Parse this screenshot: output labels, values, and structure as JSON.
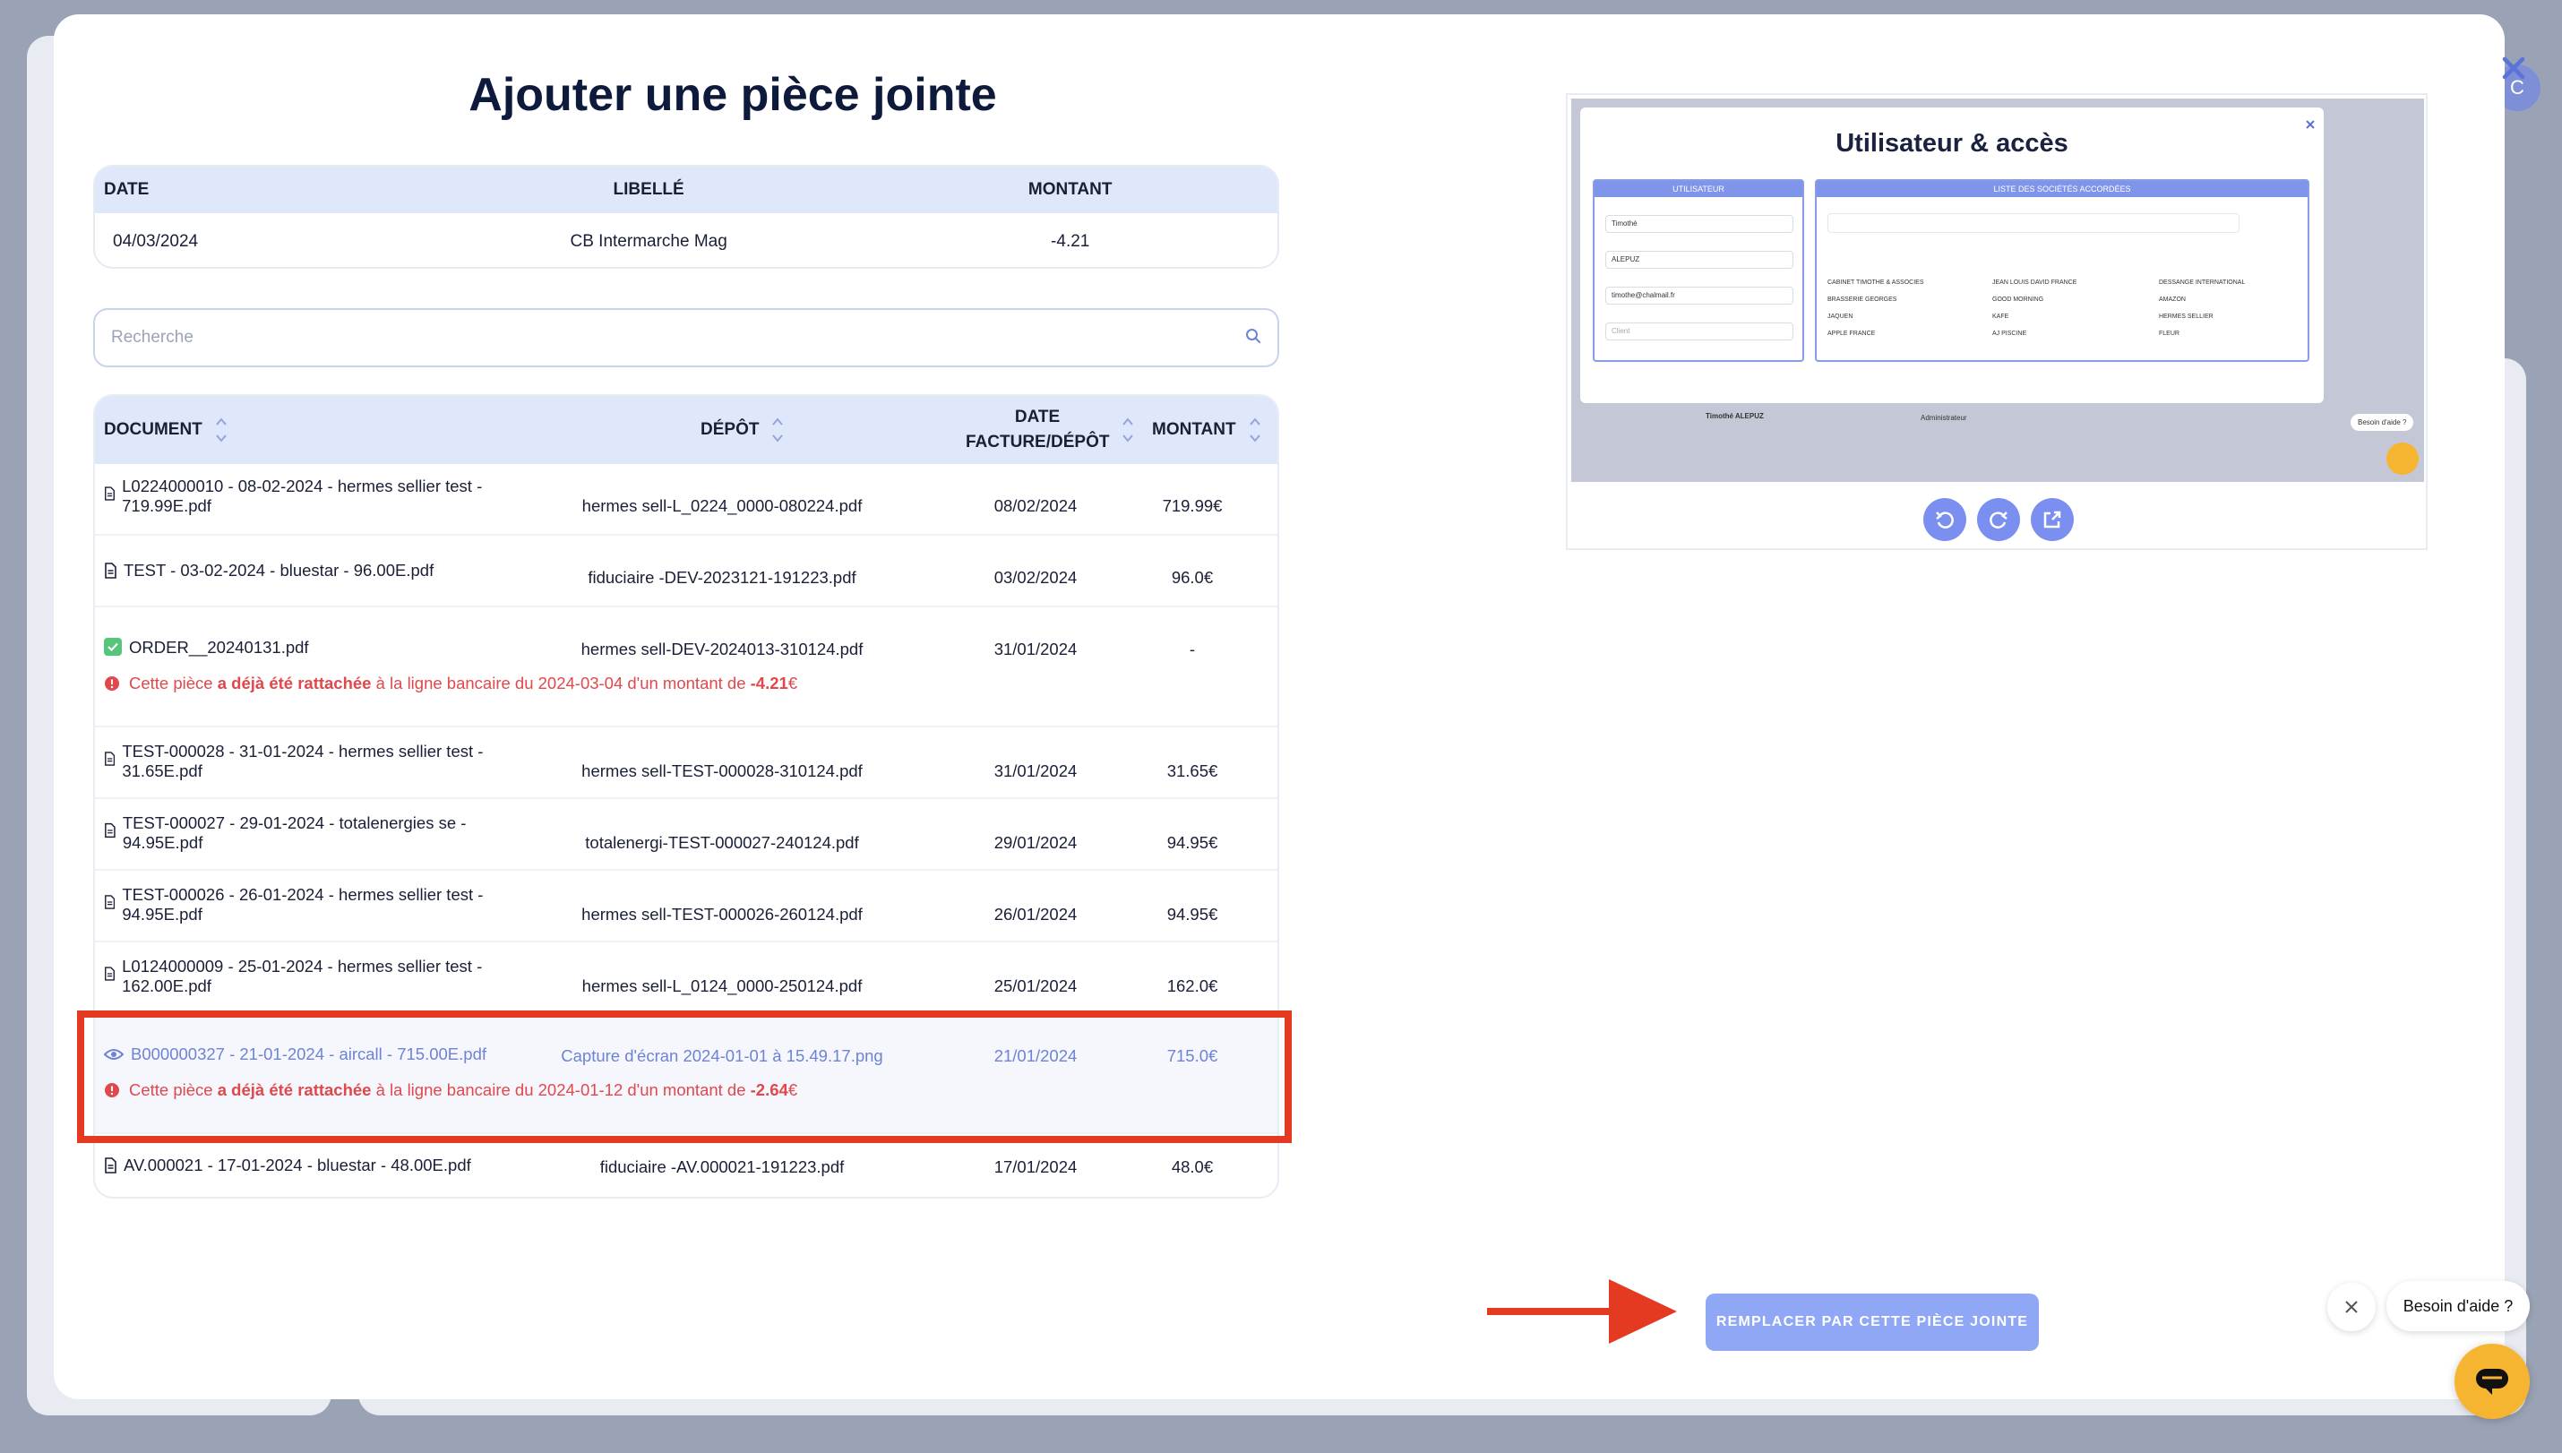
{
  "modal": {
    "title": "Ajouter une pièce jointe",
    "close_icon": "close-icon"
  },
  "transaction": {
    "headers": {
      "date": "DATE",
      "label": "LIBELLÉ",
      "amount": "MONTANT"
    },
    "date": "04/03/2024",
    "label": "CB Intermarche Mag",
    "amount": "-4.21"
  },
  "search": {
    "placeholder": "Recherche"
  },
  "documents": {
    "headers": {
      "document": "DOCUMENT",
      "deposit": "DÉPÔT",
      "date": "DATE FACTURE/DÉPÔT",
      "amount": "MONTANT"
    },
    "rows": [
      {
        "name": "L0224000010 - 08-02-2024 - hermes sellier test - 719.99E.pdf",
        "deposit": "hermes sell-L_0224_0000-080224.pdf",
        "date": "08/02/2024",
        "amount": "719.99€"
      },
      {
        "name": "TEST - 03-02-2024 - bluestar - 96.00E.pdf",
        "deposit": "fiduciaire -DEV-2023121-191223.pdf",
        "date": "03/02/2024",
        "amount": "96.0€"
      },
      {
        "name": "ORDER__20240131.pdf",
        "deposit": "hermes sell-DEV-2024013-310124.pdf",
        "date": "31/01/2024",
        "amount": "-",
        "warning": {
          "prefix": "Cette pièce ",
          "bold": "a déjà été rattachée",
          "middle": " à la ligne bancaire du 2024-03-04 d'un montant de ",
          "amount": "-4.21",
          "suffix": "€"
        }
      },
      {
        "name": "TEST-000028 - 31-01-2024 - hermes sellier test - 31.65E.pdf",
        "deposit": "hermes sell-TEST-000028-310124.pdf",
        "date": "31/01/2024",
        "amount": "31.65€"
      },
      {
        "name": "TEST-000027 - 29-01-2024 - totalenergies se - 94.95E.pdf",
        "deposit": "totalenergi-TEST-000027-240124.pdf",
        "date": "29/01/2024",
        "amount": "94.95€"
      },
      {
        "name": "TEST-000026 - 26-01-2024 - hermes sellier test - 94.95E.pdf",
        "deposit": "hermes sell-TEST-000026-260124.pdf",
        "date": "26/01/2024",
        "amount": "94.95€"
      },
      {
        "name": "L0124000009 - 25-01-2024 - hermes sellier test - 162.00E.pdf",
        "deposit": "hermes sell-L_0124_0000-250124.pdf",
        "date": "25/01/2024",
        "amount": "162.0€"
      },
      {
        "name": "B000000327 - 21-01-2024 - aircall - 715.00E.pdf",
        "deposit": "Capture d'écran 2024-01-01 à 15.49.17.png",
        "date": "21/01/2024",
        "amount": "715.0€",
        "warning": {
          "prefix": "Cette pièce ",
          "bold": "a déjà été rattachée",
          "middle": " à la ligne bancaire du 2024-01-12 d'un montant de ",
          "amount": "-2.64",
          "suffix": "€"
        }
      },
      {
        "name": "AV.000021 - 17-01-2024 - bluestar - 48.00E.pdf",
        "deposit": "fiduciaire -AV.000021-191223.pdf",
        "date": "17/01/2024",
        "amount": "48.0€"
      }
    ]
  },
  "preview": {
    "title": "Utilisateur & accès",
    "panel_user": "UTILISATEUR",
    "panel_companies": "LISTE DES SOCIÉTÉS ACCORDÉES",
    "fields": [
      "Timothé",
      "ALEPUZ",
      "timothe@chalmail.fr",
      "Client"
    ],
    "companies": [
      "CABINET TIMOTHE & ASSOCIES",
      "BRASSERIE GEORGES",
      "JAQUEN",
      "APPLE FRANCE",
      "JEAN LOUIS DAVID FRANCE",
      "GOOD MORNING",
      "KAFE",
      "AJ PISCINE",
      "DESSANGE INTERNATIONAL",
      "AMAZON",
      "HERMES SELLIER",
      "FLEUR"
    ],
    "user_row_name": "Timothé ALEPUZ",
    "user_row_role": "Administrateur",
    "help": "Besoin d'aide ?",
    "tools": [
      "rotate-left-icon",
      "rotate-right-icon",
      "open-external-icon"
    ]
  },
  "actions": {
    "replace": "REMPLACER PAR CETTE PIÈCE JOINTE"
  },
  "help_widget": {
    "label": "Besoin d'aide ?"
  },
  "colors": {
    "accent": "#7b8ff0",
    "header_bg": "#dfe7fb",
    "warning": "#e0484c",
    "highlight": "#e43a22",
    "help": "#f6b530"
  }
}
